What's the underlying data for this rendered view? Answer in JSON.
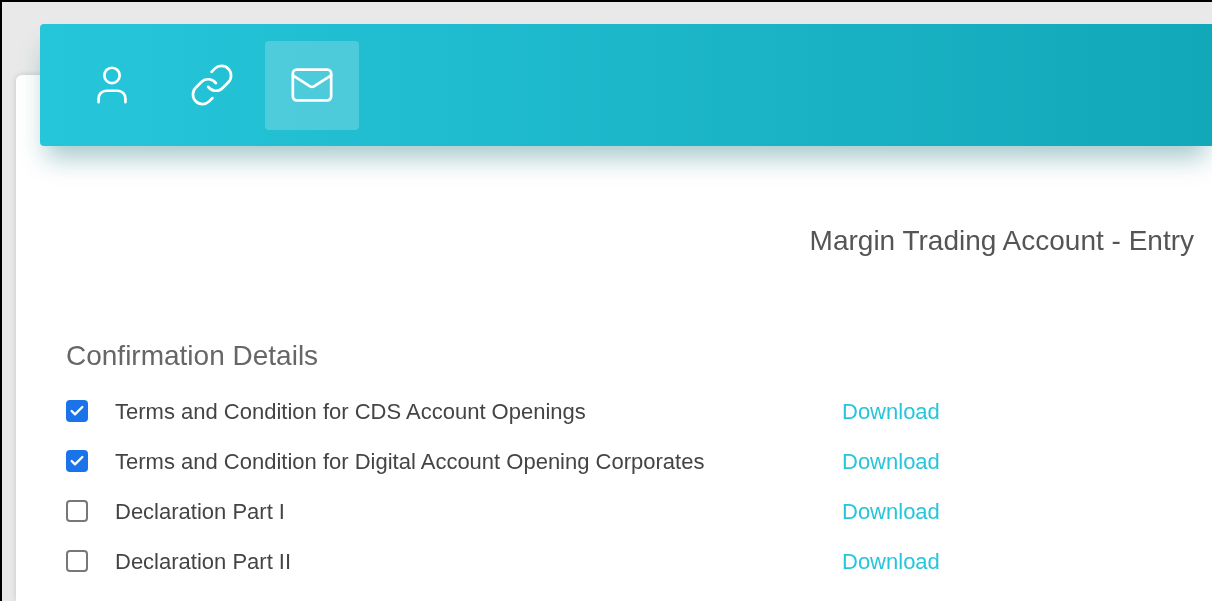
{
  "tabs": [
    {
      "kind": "person",
      "selected": false
    },
    {
      "kind": "link",
      "selected": false
    },
    {
      "kind": "mail",
      "selected": true
    }
  ],
  "title": "Margin Trading Account - Entry",
  "section": {
    "heading": "Confirmation Details",
    "items": [
      {
        "label": "Terms and Condition for CDS Account Openings",
        "checked": true,
        "link": "Download"
      },
      {
        "label": "Terms and Condition for Digital Account Opening Corporates",
        "checked": true,
        "link": "Download"
      },
      {
        "label": "Declaration Part I",
        "checked": false,
        "link": "Download"
      },
      {
        "label": "Declaration Part II",
        "checked": false,
        "link": "Download"
      }
    ]
  }
}
